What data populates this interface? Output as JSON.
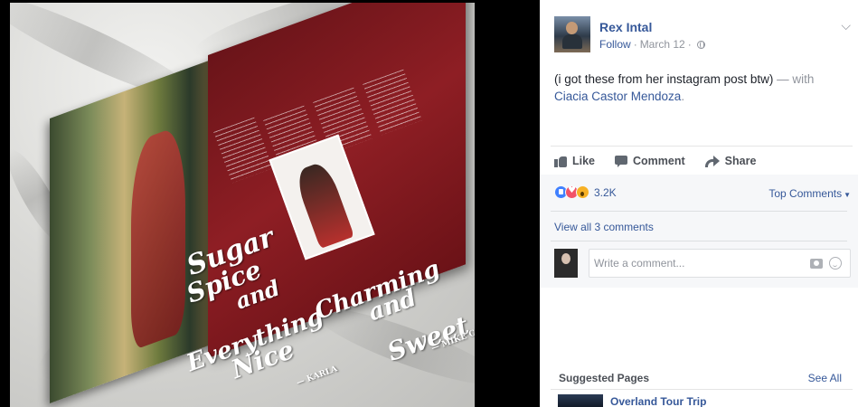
{
  "photo": {
    "left_page_text": [
      "Sugar",
      "Spice",
      "and",
      "Everything",
      "Nice",
      "— KARLA"
    ],
    "right_page_text": [
      "Charming",
      "and",
      "Sweet",
      "— MIKE CASTRO"
    ]
  },
  "post": {
    "author": "Rex Intal",
    "follow": "Follow",
    "date": "March 12",
    "separator": "·",
    "text": "(i got these from her instagram post btw)",
    "with_text": "— with",
    "tagged": "Ciacia Castor Mendoza",
    "period": "."
  },
  "actions": {
    "like": "Like",
    "comment": "Comment",
    "share": "Share"
  },
  "reactions": {
    "count": "3.2K",
    "types": [
      "like-icon",
      "love-icon",
      "wow-icon"
    ]
  },
  "comments": {
    "sort": "Top Comments",
    "view_all": "View all 3 comments",
    "placeholder": "Write a comment..."
  },
  "suggested": {
    "title": "Suggested Pages",
    "see_all": "See All",
    "first_page": "Overland Tour Trip"
  },
  "colors": {
    "link": "#365899",
    "muted": "#90949c",
    "text": "#1d2129"
  }
}
